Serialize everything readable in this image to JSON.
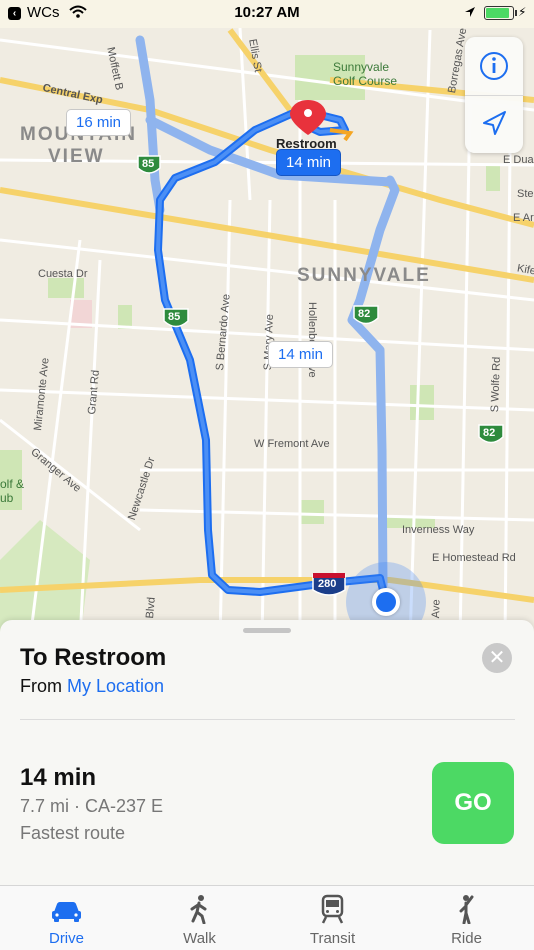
{
  "status_bar": {
    "carrier": "WCs",
    "time": "10:27 AM",
    "battery_level": 0.9
  },
  "map": {
    "city_labels": {
      "mountain": "MOUNTAIN",
      "view": "VIEW",
      "sunnyvale": "SUNNYVALE"
    },
    "destination_label": "Restroom",
    "park_label_line1": "Sunnyvale",
    "park_label_line2": "Golf Course",
    "golf_left_line1": "olf &",
    "golf_left_line2": "ub",
    "streets": {
      "moffett": "Moffett B",
      "ellis": "Ellis St",
      "central": "Central Exp",
      "borregas": "Borregas Ave",
      "e_duane": "E Duan",
      "ste": "Ste",
      "e_arq": "E Ar",
      "kifer": "Kife",
      "cuesta": "Cuesta Dr",
      "s_bernardo": "S Bernardo Ave",
      "s_mary": "S Mary Ave",
      "hollenbeck": "Hollenbeck Ave",
      "s_wolfe": "S Wolfe Rd",
      "miramonte": "Miramonte Ave",
      "grant": "Grant Rd",
      "w_fremont": "W Fremont Ave",
      "granger": "Granger Ave",
      "newcastle": "Newcastle Dr",
      "inverness": "Inverness Way",
      "e_homestead": "E Homestead Rd",
      "blvd": "Blvd",
      "ave": "Ave"
    },
    "shields": {
      "hwy85": "85",
      "hwy82": "82",
      "i280": "280"
    },
    "time_bubbles": {
      "selected": "14 min",
      "alt_left": "16 min",
      "alt_right": "14 min"
    },
    "controls": {
      "info": "info-icon",
      "locate": "location-arrow-icon"
    }
  },
  "sheet": {
    "title": "To Restroom",
    "from_prefix": "From",
    "from_link": "My Location",
    "close_label": "✕",
    "route_time": "14 min",
    "route_detail": "7.7 mi · CA-237 E",
    "route_note": "Fastest route",
    "go_label": "GO"
  },
  "tabs": [
    {
      "label": "Drive",
      "icon": "car-icon",
      "active": true
    },
    {
      "label": "Walk",
      "icon": "walk-icon",
      "active": false
    },
    {
      "label": "Transit",
      "icon": "train-icon",
      "active": false
    },
    {
      "label": "Ride",
      "icon": "ride-icon",
      "active": false
    }
  ],
  "colors": {
    "accent": "#1d6ef0",
    "go": "#4cd964",
    "pin": "#e8323c"
  }
}
